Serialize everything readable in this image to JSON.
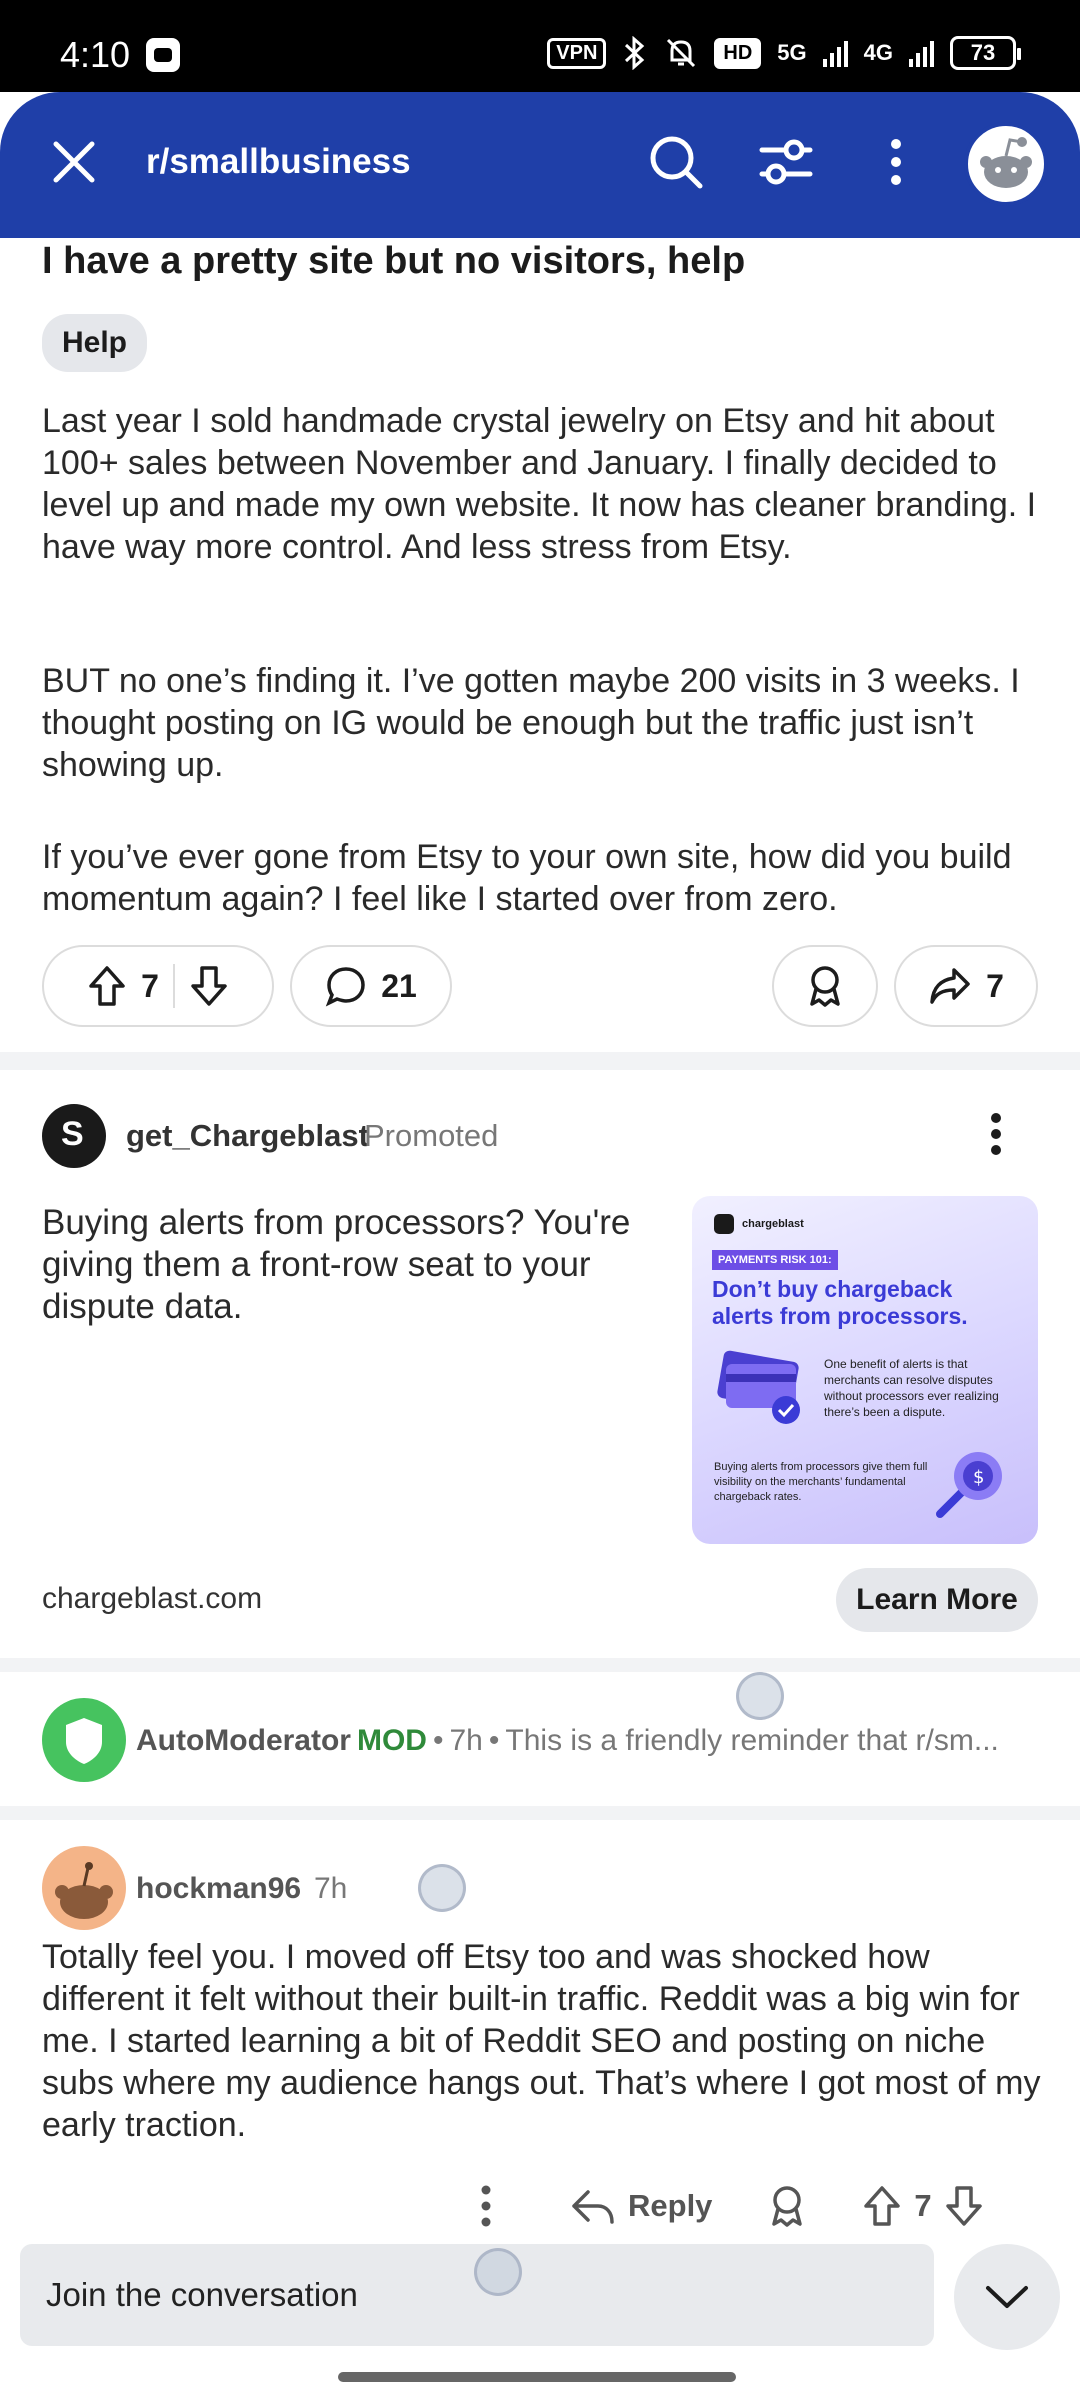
{
  "status_bar": {
    "time": "4:10",
    "vpn_label": "VPN",
    "hd_label": "HD",
    "network_5g": "5G",
    "network_4g": "4G",
    "battery": "73"
  },
  "header": {
    "subreddit": "r/smallbusiness",
    "color": "#1f3fa8"
  },
  "post": {
    "title": "I have a pretty site but no visitors, help",
    "flair": "Help",
    "paragraphs": [
      "Last year I sold handmade crystal jewelry on Etsy and hit about 100+ sales between November and January. I finally decided to level up and made my own website. It now has cleaner branding. I have way more control. And less stress from Etsy.",
      "BUT no one’s finding it. I’ve gotten maybe 200 visits in 3 weeks. I thought posting on IG would be enough but the traffic just isn’t showing up.",
      "If you’ve ever gone from Etsy to your own site, how did you build momentum again? I feel like I started over from zero."
    ],
    "upvotes": "7",
    "comments": "21",
    "shares": "7"
  },
  "ad": {
    "advertiser": "get_Chargeblast",
    "promoted_label": "Promoted",
    "text": "Buying alerts from processors? You're giving them a front-row seat to your dispute data.",
    "domain": "chargeblast.com",
    "cta": "Learn More",
    "image": {
      "brand": "chargeblast",
      "badge": "PAYMENTS RISK 101:",
      "headline": "Don’t buy chargeback alerts from processors.",
      "text1": "One benefit of alerts is that merchants can resolve disputes without processors ever realizing there’s been a dispute.",
      "text2": "Buying alerts from processors give them full visibility on the merchants’ fundamental chargeback rates."
    }
  },
  "automod": {
    "name": "AutoModerator",
    "badge": "MOD",
    "time": "7h",
    "preview": "This is a friendly reminder that r/sm...",
    "separator": "•"
  },
  "comment": {
    "author": "hockman96",
    "time": "7h",
    "text": "Totally feel you. I moved off Etsy too and was shocked how different it felt without their built-in traffic. Reddit was a big win for me. I started learning a bit of Reddit SEO and posting on niche subs where my audience hangs out. That’s where I got most of my early traction.",
    "reply_label": "Reply",
    "votes": "7"
  },
  "composer": {
    "placeholder": "Join the conversation"
  }
}
